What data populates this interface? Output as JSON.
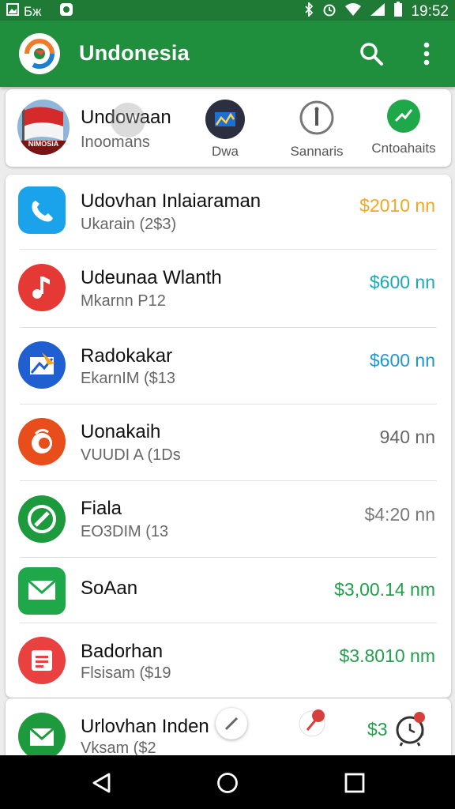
{
  "status_bar": {
    "carrier": "Бж",
    "time": "19:52",
    "icons": [
      "image-icon",
      "app-icon",
      "bluetooth-icon",
      "alarm-icon",
      "wifi-icon",
      "signal-icon",
      "battery-icon"
    ]
  },
  "app_bar": {
    "title": "Undonesia",
    "actions": [
      "search-icon",
      "more-vert-icon"
    ]
  },
  "featured": {
    "flag_caption": "NIMOSIA",
    "title": "Undowaan",
    "subtitle": "Inoomans",
    "shortcuts": [
      {
        "label": "Dwa",
        "icon": "chart-icon"
      },
      {
        "label": "Sannaris",
        "icon": "info-icon"
      },
      {
        "label": "Cntoahaits",
        "icon": "trend-icon"
      }
    ]
  },
  "transactions": [
    {
      "title": "Udovhan Inlaiaraman",
      "subtitle": "Ukarain (2$3)",
      "amount": "$2010 nn",
      "icon": "phone-icon",
      "amount_color": "#f5a623"
    },
    {
      "title": "Udeunaa Wlanth",
      "subtitle": "Mkarnn P12",
      "amount": "$600 nn",
      "icon": "music-icon",
      "amount_color": "#1ba9b6"
    },
    {
      "title": "Radokakar",
      "subtitle": "EkarnIM ($13",
      "amount": "$600 nn",
      "icon": "arrow-icon",
      "amount_color": "#1e96d6"
    },
    {
      "title": "Uonakaih",
      "subtitle": "VUUDI A (1Ds",
      "amount": "940 nn",
      "icon": "circle-icon",
      "amount_color": "#666666"
    },
    {
      "title": "Fiala",
      "subtitle": "EO3DIM (13",
      "amount": "$4:20 nn",
      "icon": "check-icon",
      "amount_color": "#7a7a7a"
    },
    {
      "title": "SoAan",
      "subtitle": "",
      "amount": "$3,00.14 nm",
      "icon": "mail-icon",
      "amount_color": "#21a04c"
    },
    {
      "title": "Badorhan",
      "subtitle": "Flsisam ($19",
      "amount": "$3.8010 nm",
      "icon": "document-icon",
      "amount_color": "#21a04c"
    }
  ],
  "partial_item": {
    "title": "Urlovhan Inden",
    "subtitle": "Vksam ($2",
    "amount": "$3",
    "amount_suffix": "m",
    "icons": [
      "mail-icon",
      "edit-icon",
      "pin-icon",
      "alarm-clock-icon"
    ]
  },
  "nav_bar": {
    "buttons": [
      "back-icon",
      "home-icon",
      "recents-icon"
    ]
  }
}
